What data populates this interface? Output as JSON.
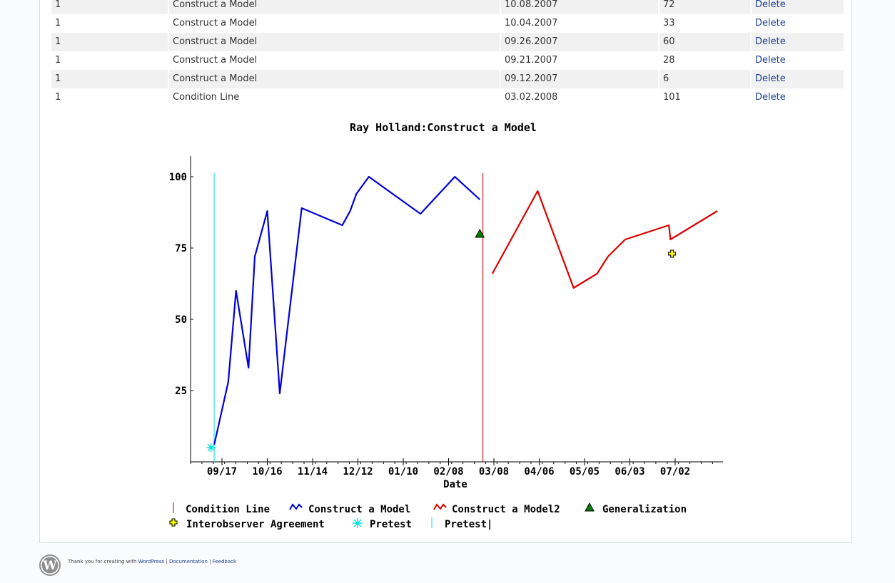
{
  "table": {
    "rows": [
      {
        "num": "1",
        "name": "Construct a Model",
        "date": "10.08.2007",
        "value": "72",
        "action": "Delete"
      },
      {
        "num": "1",
        "name": "Construct a Model",
        "date": "10.04.2007",
        "value": "33",
        "action": "Delete"
      },
      {
        "num": "1",
        "name": "Construct a Model",
        "date": "09.26.2007",
        "value": "60",
        "action": "Delete"
      },
      {
        "num": "1",
        "name": "Construct a Model",
        "date": "09.21.2007",
        "value": "28",
        "action": "Delete"
      },
      {
        "num": "1",
        "name": "Construct a Model",
        "date": "09.12.2007",
        "value": "6",
        "action": "Delete"
      },
      {
        "num": "1",
        "name": "Condition Line",
        "date": "03.02.2008",
        "value": "101",
        "action": "Delete"
      }
    ]
  },
  "chart_data": {
    "type": "line",
    "title": "Ray Holland:Construct a Model",
    "xlabel": "Date",
    "ylabel": "",
    "x_ticks": [
      "09/17",
      "10/16",
      "11/14",
      "12/12",
      "01/10",
      "02/08",
      "03/08",
      "04/06",
      "05/05",
      "06/03",
      "07/02"
    ],
    "y_ticks": [
      "25",
      "50",
      "75",
      "100"
    ],
    "ylim": [
      0,
      105
    ],
    "series": [
      {
        "name": "Construct a Model",
        "color": "#0000dd",
        "marker": "none",
        "x": [
          "2007-09-12",
          "2007-09-21",
          "2007-09-26",
          "2007-10-04",
          "2007-10-08",
          "2007-10-16",
          "2007-10-24",
          "2007-11-07",
          "2007-12-03",
          "2007-12-08",
          "2007-12-12",
          "2007-12-20",
          "2008-01-22",
          "2008-02-13",
          "2008-02-29"
        ],
        "y": [
          6,
          28,
          60,
          33,
          72,
          88,
          24,
          89,
          83,
          88,
          94,
          100,
          87,
          100,
          92
        ]
      },
      {
        "name": "Construct a Model2",
        "color": "#dd0000",
        "marker": "none",
        "x": [
          "2008-03-08",
          "2008-04-06",
          "2008-04-29",
          "2008-05-14",
          "2008-05-21",
          "2008-06-01",
          "2008-06-29",
          "2008-06-30",
          "2008-07-30"
        ],
        "y": [
          66,
          95,
          61,
          66,
          72,
          78,
          83,
          78,
          88
        ]
      },
      {
        "name": "Generalization",
        "color": "#008000",
        "marker": "triangle",
        "x": [
          "2008-02-29"
        ],
        "y": [
          80
        ]
      },
      {
        "name": "Interobserver Agreement",
        "color": "#ffff00",
        "marker": "plus",
        "x": [
          "2008-07-01"
        ],
        "y": [
          73
        ]
      },
      {
        "name": "Pretest",
        "color": "#00dddd",
        "marker": "star",
        "x": [
          "2007-09-10"
        ],
        "y": [
          5
        ]
      }
    ],
    "vertical_lines": [
      {
        "name": "Condition Line",
        "color": "#aa0000",
        "x": "2008-03-02"
      },
      {
        "name": "Pretest|",
        "color": "#00dddd",
        "x": "2007-09-12"
      }
    ],
    "legend": [
      {
        "label": "Condition Line",
        "symbol": "vline",
        "color": "#aa0000"
      },
      {
        "label": "Construct a Model",
        "symbol": "zigzag",
        "color": "#0000dd"
      },
      {
        "label": "Construct a Model2",
        "symbol": "zigzag",
        "color": "#dd0000"
      },
      {
        "label": "Generalization",
        "symbol": "triangle",
        "color": "#008000"
      },
      {
        "label": "Interobserver Agreement",
        "symbol": "plus",
        "color": "#ffff00"
      },
      {
        "label": "Pretest",
        "symbol": "star",
        "color": "#00dddd"
      },
      {
        "label": "Pretest|",
        "symbol": "vline",
        "color": "#00dddd"
      }
    ],
    "legend_position": "bottom"
  },
  "footer": {
    "prefix": "Thank you for creating with ",
    "wordpress": "WordPress",
    "sep1": " | ",
    "documentation": "Documentation",
    "sep2": " | ",
    "feedback": "Feedback"
  },
  "icons": {
    "footer_logo": "wordpress-logo-icon"
  }
}
